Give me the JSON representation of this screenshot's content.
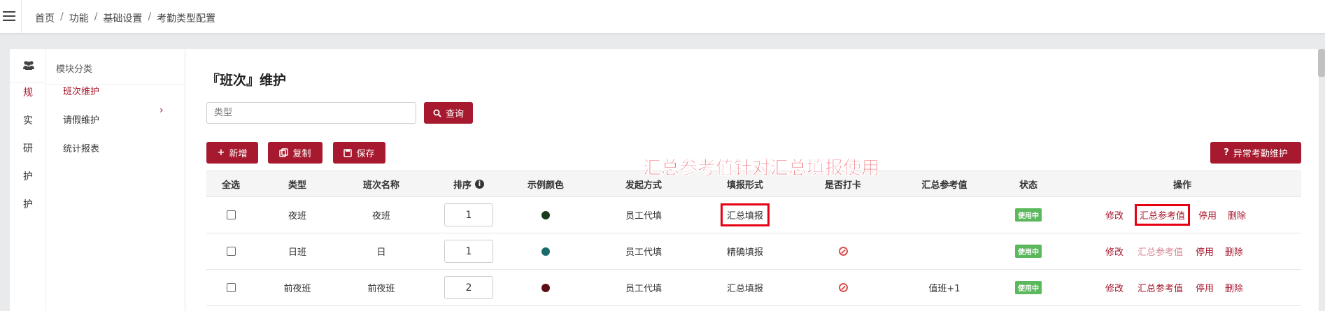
{
  "breadcrumb": [
    "首页",
    "功能",
    "基础设置",
    "考勤类型配置"
  ],
  "rail": {
    "items": [
      "规",
      "实",
      "研",
      "护",
      "护"
    ]
  },
  "submenu": {
    "header": "模块分类",
    "items": [
      "班次维护",
      "请假维护",
      "统计报表"
    ]
  },
  "page": {
    "title": "『班次』维护",
    "search_placeholder": "类型",
    "query_label": "查询",
    "add_label": "新增",
    "copy_label": "复制",
    "save_label": "保存",
    "abnormal_label": "异常考勤维护"
  },
  "table": {
    "columns": [
      "全选",
      "类型",
      "班次名称",
      "排序",
      "示例颜色",
      "发起方式",
      "填报形式",
      "是否打卡",
      "汇总参考值",
      "状态",
      "操作"
    ],
    "rows": [
      {
        "type": "夜班",
        "name": "夜班",
        "order": "1",
        "color": "#1a3a1a",
        "initiate": "员工代填",
        "fill": "汇总填报",
        "clock": "",
        "ref": "",
        "status": "使用中",
        "ops": [
          "修改",
          "汇总参考值",
          "停用",
          "删除"
        ]
      },
      {
        "type": "日班",
        "name": "日",
        "order": "1",
        "color": "#1a6b6b",
        "initiate": "员工代填",
        "fill": "精确填报",
        "clock": "forbid",
        "ref": "",
        "status": "使用中",
        "ops": [
          "修改",
          "汇总参考值",
          "停用",
          "删除"
        ]
      },
      {
        "type": "前夜班",
        "name": "前夜班",
        "order": "2",
        "color": "#5a0f14",
        "initiate": "员工代填",
        "fill": "汇总填报",
        "clock": "forbid",
        "ref": "值班+1",
        "status": "使用中",
        "ops": [
          "修改",
          "汇总参考值",
          "停用",
          "删除"
        ]
      }
    ]
  },
  "annotation": "汇总参考值针对汇总填报使用",
  "colors": {
    "brand": "#a6192e",
    "badge": "#5cb85c",
    "highlight": "#e60012"
  }
}
